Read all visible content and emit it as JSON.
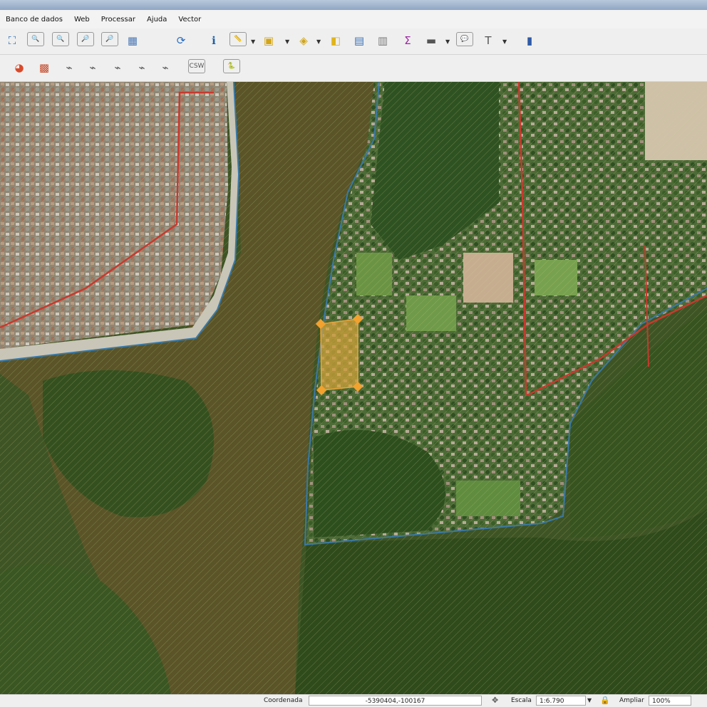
{
  "menu": [
    "Banco de dados",
    "Web",
    "Processar",
    "Ajuda",
    "Vector"
  ],
  "toolbar1": [
    {
      "icon": "zoom-full-icon",
      "glyph": "⛶",
      "color": "#2b6fb6"
    },
    {
      "icon": "zoom-selection-icon",
      "glyph": "🔍",
      "color": "#c79a12"
    },
    {
      "icon": "zoom-layer-icon",
      "glyph": "🔍",
      "color": "#3a7fc1"
    },
    {
      "icon": "zoom-last-icon",
      "glyph": "🔎",
      "color": "#3a7fc1"
    },
    {
      "icon": "zoom-next-icon",
      "glyph": "🔎",
      "color": "#6a8fb3"
    },
    {
      "icon": "new-bookmark-icon",
      "glyph": "▦",
      "color": "#4a78b4"
    },
    {
      "icon": "refresh-icon",
      "glyph": "⟳",
      "color": "#2a6fc0"
    },
    {
      "icon": "identify-icon",
      "glyph": "ℹ",
      "color": "#1f5fa8"
    },
    {
      "icon": "measure-icon",
      "glyph": "📏",
      "color": "#7d8a99"
    },
    {
      "icon": "select-features-icon",
      "glyph": "▣",
      "color": "#d2a516"
    },
    {
      "icon": "select-value-icon",
      "glyph": "◈",
      "color": "#d2a516"
    },
    {
      "icon": "deselect-icon",
      "glyph": "◧",
      "color": "#e0b41c"
    },
    {
      "icon": "attribute-table-icon",
      "glyph": "▤",
      "color": "#3a72b8"
    },
    {
      "icon": "field-calculator-icon",
      "glyph": "▥",
      "color": "#7a7a7a"
    },
    {
      "icon": "statistics-icon",
      "glyph": "Σ",
      "color": "#9b2aa1"
    },
    {
      "icon": "measure-line-icon",
      "glyph": "▬",
      "color": "#555555"
    },
    {
      "icon": "annotation-icon",
      "glyph": "💬",
      "color": "#e6c21a"
    },
    {
      "icon": "text-annotation-icon",
      "glyph": "T",
      "color": "#555555"
    },
    {
      "icon": "map-tips-icon",
      "glyph": "▮",
      "color": "#2f5aa6"
    }
  ],
  "toolbar2": [
    {
      "icon": "pie-chart-icon",
      "glyph": "◕",
      "color": "#d94a2a"
    },
    {
      "icon": "raster-calculator-icon",
      "glyph": "▩",
      "color": "#c64a2a"
    },
    {
      "icon": "digitize-icon",
      "glyph": "⌁",
      "color": "#555555"
    },
    {
      "icon": "add-feature-icon",
      "glyph": "⌁",
      "color": "#555555"
    },
    {
      "icon": "move-feature-icon",
      "glyph": "⌁",
      "color": "#555555"
    },
    {
      "icon": "node-tool-icon",
      "glyph": "⌁",
      "color": "#555555"
    },
    {
      "icon": "delete-feature-icon",
      "glyph": "⌁",
      "color": "#555555"
    },
    {
      "icon": "csw-icon",
      "glyph": "CSW",
      "color": "#555555"
    },
    {
      "icon": "python-console-icon",
      "glyph": "🐍",
      "color": "#3b6fb0"
    }
  ],
  "status": {
    "coord_label": "Coordenada",
    "coord_value": "-5390404,-100167",
    "scale_label": "Escala",
    "scale_value": "1:6.790",
    "magnify_label": "Ampliar",
    "magnify_value": "100%"
  }
}
